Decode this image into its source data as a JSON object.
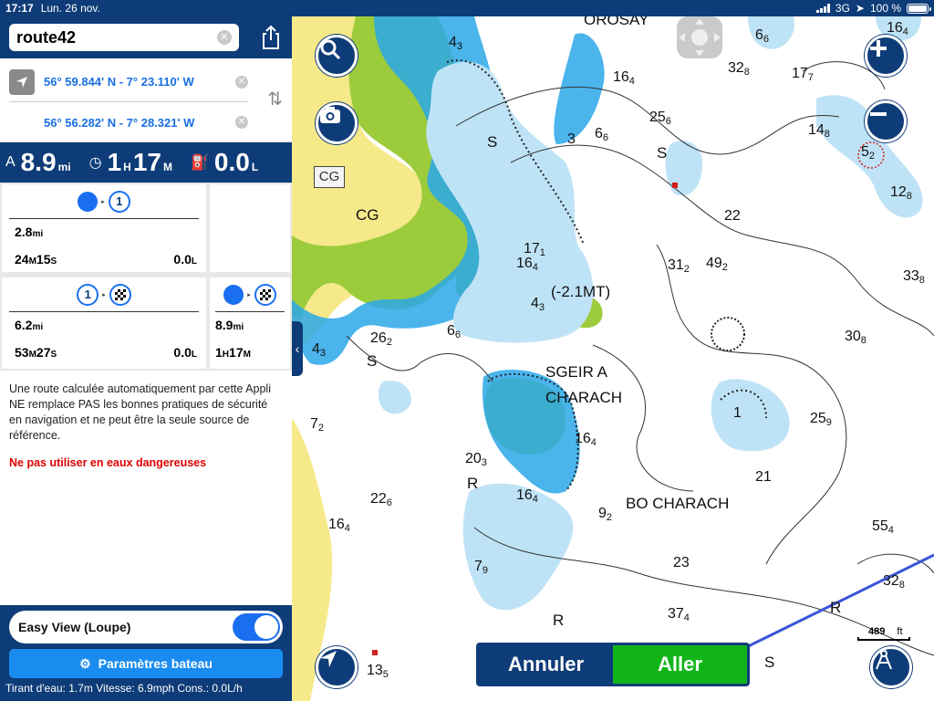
{
  "status": {
    "time": "17:17",
    "date": "Lun. 26 nov.",
    "network": "3G",
    "battery": "100 %"
  },
  "route": {
    "name": "route42",
    "start": "56° 59.844' N - 7° 23.110' W",
    "end": "56° 56.282' N - 7° 28.321' W"
  },
  "summary": {
    "distance": "8.9",
    "distance_unit": "mi",
    "hours": "1",
    "hours_unit": "H",
    "minutes": "17",
    "minutes_unit": "M",
    "fuel": "0.0",
    "fuel_unit": "L"
  },
  "legs": [
    {
      "to": "1",
      "distance": "2.8",
      "distance_unit": "mi",
      "time_m": "24",
      "time_s": "15",
      "fuel": "0.0",
      "fuel_unit": "L"
    },
    {
      "from": "1",
      "distance": "6.2",
      "distance_unit": "mi",
      "time_m": "53",
      "time_s": "27",
      "fuel": "0.0",
      "fuel_unit": "L"
    },
    {
      "distance": "8.9",
      "distance_unit": "mi",
      "time_h": "1",
      "time_m": "17"
    }
  ],
  "disclaimer": "Une route calculée automatiquement par cette Appli NE remplace PAS les bonnes pratiques de sécurité en navigation et ne peut être la seule source de référence.",
  "warning": "Ne pas utiliser en eaux dangereuses",
  "easy_view_label": "Easy View (Loupe)",
  "easy_view_on": true,
  "params_label": "Paramètres bateau",
  "footer": "Tirant d'eau: 1.7m Vitesse: 6.9mph Cons.: 0.0L/h",
  "map": {
    "cg_label": "CG",
    "places": [
      "CG",
      "SGEIR A",
      "CHARACH",
      "BO CHARACH",
      "(-2.1MT)",
      "OROSAY"
    ],
    "scale_value": "489",
    "scale_unit": "ft",
    "cancel_label": "Annuler",
    "go_label": "Aller"
  },
  "colors": {
    "navy": "#0e3c78",
    "accent_blue": "#1a6ff0",
    "go_green": "#12b519",
    "warning_red": "#e00000",
    "land": "#f5e98a",
    "shallow": "#2aa7e8",
    "medium": "#bfe3f6",
    "green_flat": "#9ccc3c"
  }
}
